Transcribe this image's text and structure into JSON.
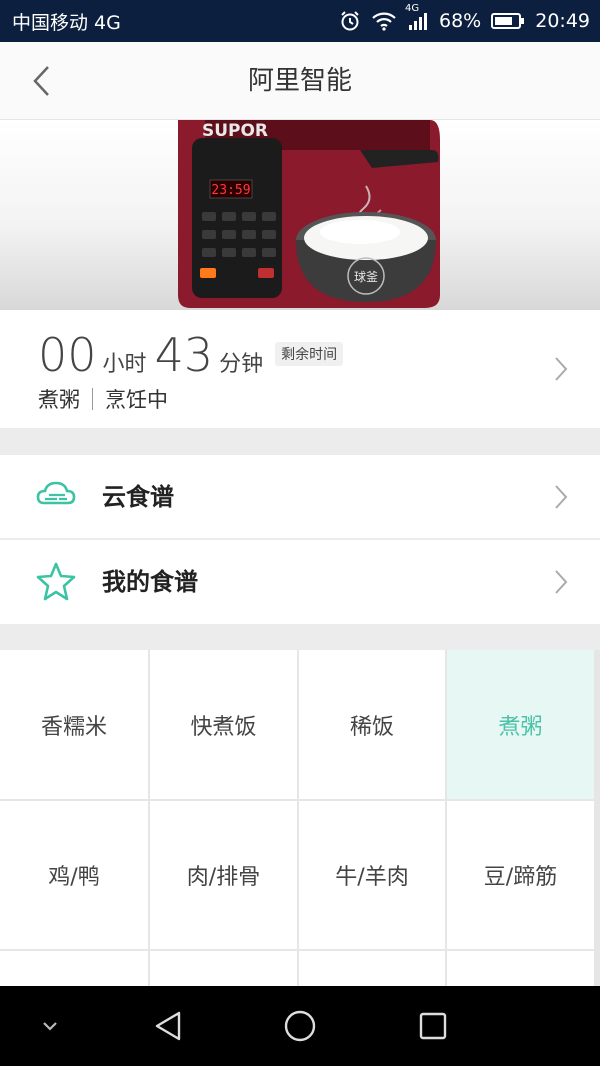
{
  "status_bar": {
    "carrier": "中国移动 4G",
    "network_badge": "4G",
    "battery": "68%",
    "time": "20:49",
    "icons": [
      "alarm-icon",
      "wifi-icon",
      "signal-icon",
      "battery-icon"
    ]
  },
  "header": {
    "title": "阿里智能",
    "back_icon": "chevron-left-icon"
  },
  "banner": {
    "brand": "SUPOR",
    "display_time": "23:59",
    "pot_label": "球釜"
  },
  "timer": {
    "hours": "00",
    "hours_unit": "小时",
    "minutes": "43",
    "minutes_unit": "分钟",
    "remaining_label": "剩余时间",
    "mode": "煮粥",
    "state": "烹饪中"
  },
  "menu": [
    {
      "label": "云食谱",
      "icon": "cloud-icon"
    },
    {
      "label": "我的食谱",
      "icon": "star-icon"
    }
  ],
  "programs": [
    {
      "label": "香糯米",
      "active": false
    },
    {
      "label": "快煮饭",
      "active": false
    },
    {
      "label": "稀饭",
      "active": false
    },
    {
      "label": "煮粥",
      "active": true
    },
    {
      "label": "鸡/鸭",
      "active": false
    },
    {
      "label": "肉/排骨",
      "active": false
    },
    {
      "label": "牛/羊肉",
      "active": false
    },
    {
      "label": "豆/蹄筋",
      "active": false
    }
  ],
  "colors": {
    "accent": "#4cc3a9",
    "active_bg": "#e7f7f3",
    "status_bar": "#0c1f3e"
  },
  "nav": [
    "collapse-icon",
    "back-triangle-icon",
    "home-circle-icon",
    "recents-square-icon"
  ]
}
